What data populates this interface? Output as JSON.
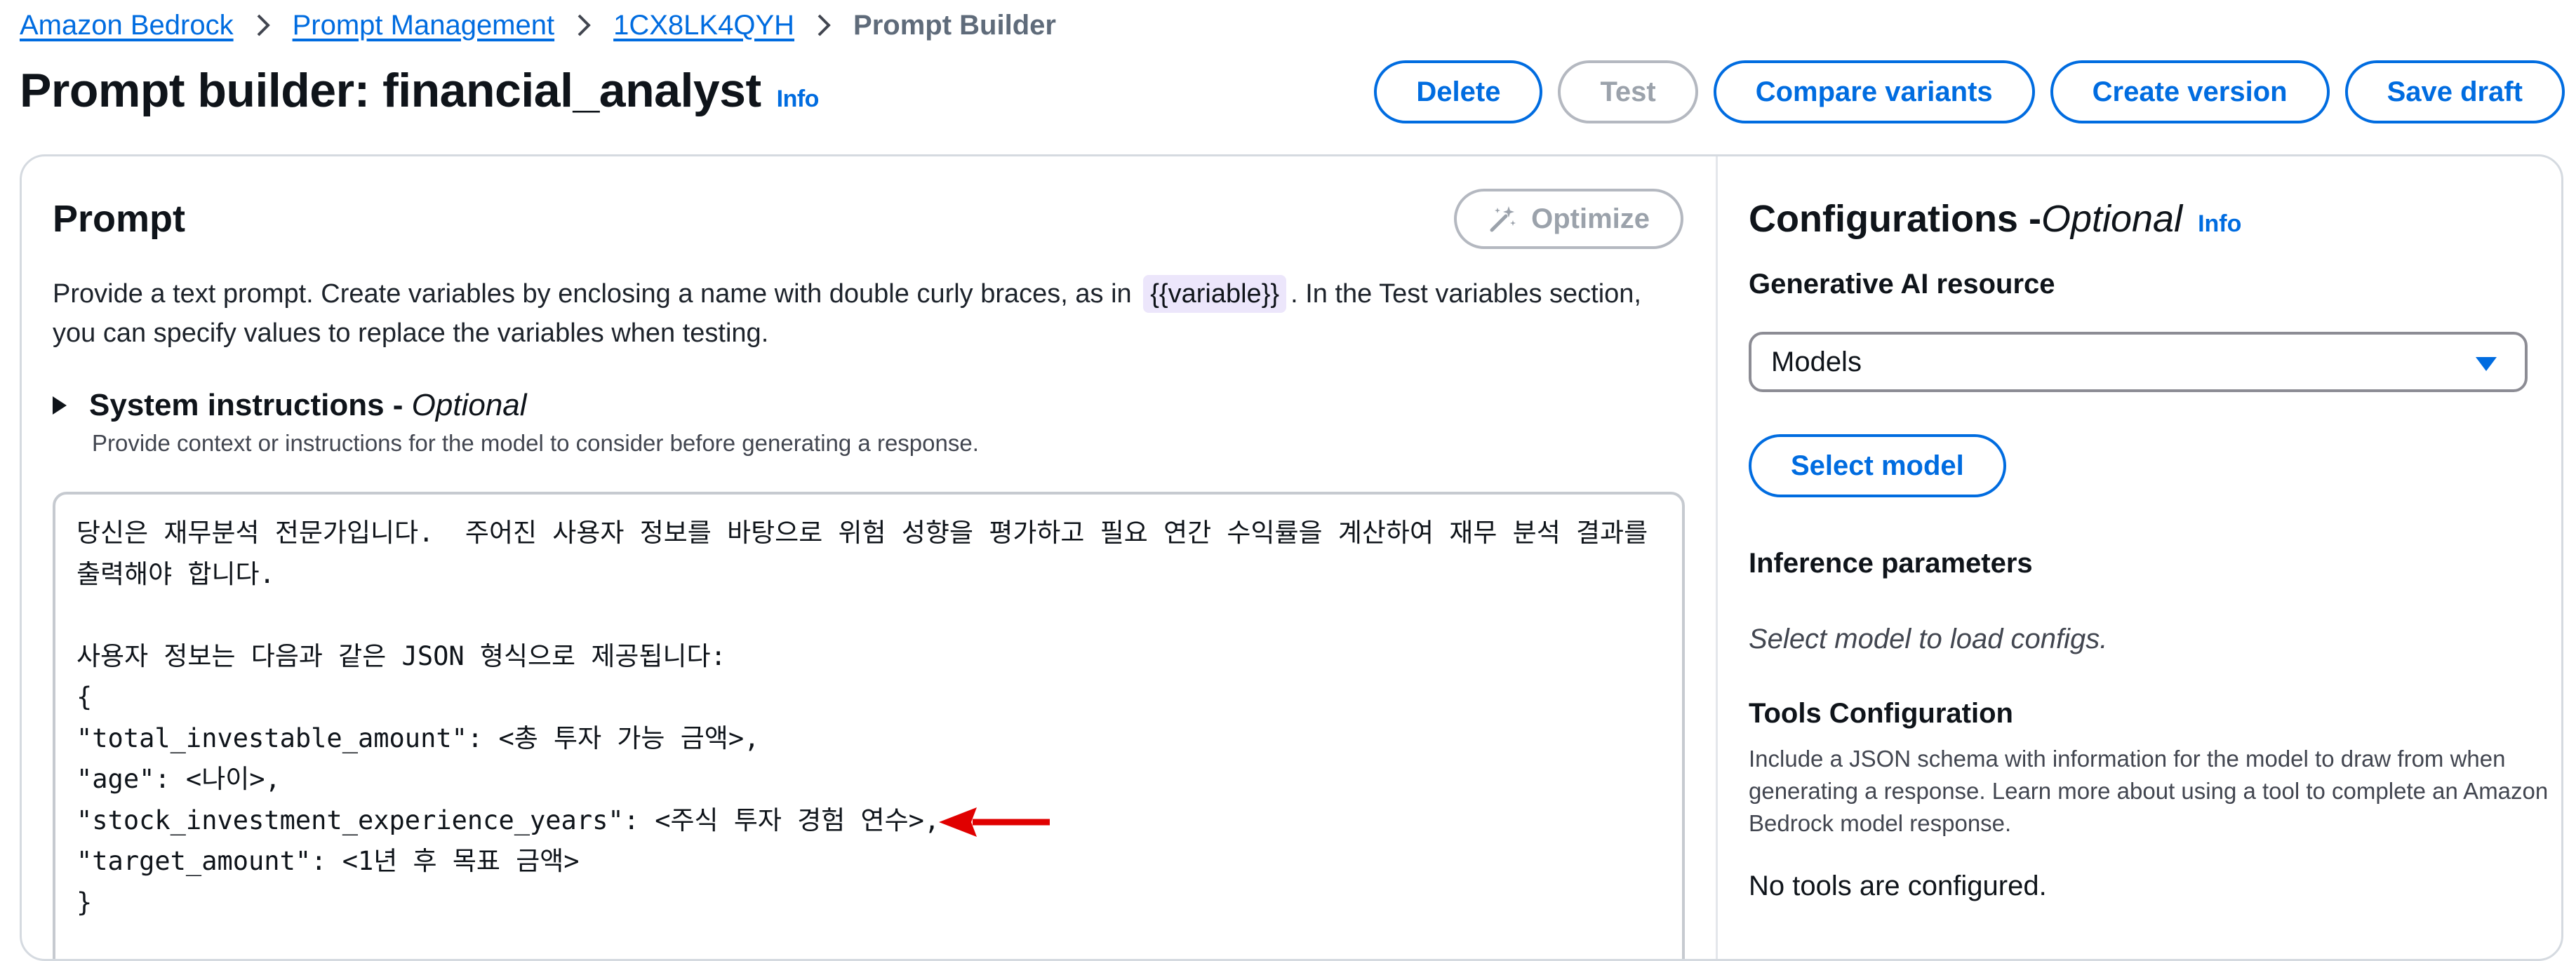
{
  "breadcrumb": {
    "items": [
      "Amazon Bedrock",
      "Prompt Management",
      "1CX8LK4QYH"
    ],
    "current": "Prompt Builder"
  },
  "header": {
    "title": "Prompt builder: financial_analyst",
    "info": "Info",
    "actions": {
      "delete": "Delete",
      "test": "Test",
      "compare": "Compare variants",
      "create_version": "Create version",
      "save_draft": "Save draft"
    }
  },
  "prompt": {
    "title": "Prompt",
    "optimize": "Optimize",
    "description_before": "Provide a text prompt. Create variables by enclosing a name with double curly braces, as in",
    "variable_example": "{{variable}}",
    "description_after": ". In the Test variables section, you can specify values to replace the variables when testing.",
    "system_instructions": {
      "title": "System instructions - ",
      "optional": "Optional",
      "subtitle": "Provide context or instructions for the model to consider before generating a response."
    },
    "text": "당신은 재무분석 전문가입니다.  주어진 사용자 정보를 바탕으로 위험 성향을 평가하고 필요 연간 수익률을 계산하여 재무 분석 결과를 출력해야 합니다.\n\n사용자 정보는 다음과 같은 JSON 형식으로 제공됩니다:\n{\n\"total_investable_amount\": <총 투자 가능 금액>,\n\"age\": <나이>,\n\"stock_investment_experience_years\": <주식 투자 경험 연수>,\n\"target_amount\": <1년 후 목표 금액>\n}"
  },
  "config": {
    "title": "Configurations - ",
    "optional": "Optional",
    "info": "Info",
    "gen_ai_label": "Generative AI resource",
    "resource_selected": "Models",
    "select_model": "Select model",
    "inference_label": "Inference parameters",
    "inference_note": "Select model to load configs.",
    "tools_label": "Tools Configuration",
    "tools_desc": "Include a JSON schema with information for the model to draw from when generating a response. Learn more about using a tool to complete an Amazon Bedrock model response.",
    "no_tools": "No tools are configured."
  },
  "colors": {
    "link": "#006ce0",
    "disabled": "#9ba2ab",
    "annotation_arrow": "#e00000",
    "variable_chip_bg": "#ece6fb"
  }
}
